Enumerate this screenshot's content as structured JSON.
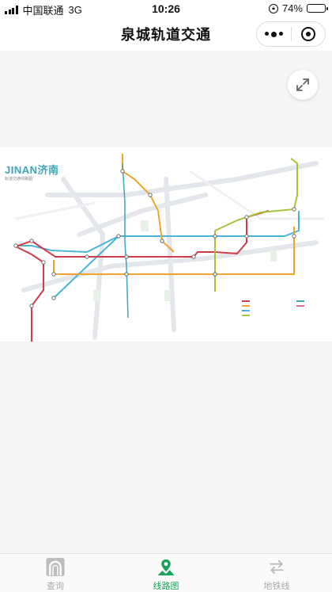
{
  "status_bar": {
    "carrier": "中国联通",
    "network": "3G",
    "time": "10:26",
    "battery": "74%",
    "battery_level": 0.74
  },
  "nav": {
    "title": "泉城轨道交通"
  },
  "map": {
    "logo_latin": "JINAN",
    "logo_cn": "济南",
    "subtitle": "轨道交通线路图",
    "line_colors": {
      "line1_red": "#d23a4a",
      "line2_orange": "#f0a52a",
      "line3_blue": "#4ab5d8",
      "line4_green": "#a8c23a",
      "line5_pink": "#e36b9a"
    }
  },
  "tabs": [
    {
      "label": "查询",
      "icon": "tunnel-icon"
    },
    {
      "label": "线路图",
      "icon": "map-pin-icon"
    },
    {
      "label": "地铁线",
      "icon": "swap-arrows-icon"
    }
  ]
}
